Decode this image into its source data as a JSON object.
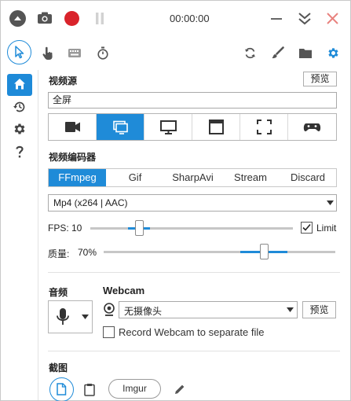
{
  "titlebar": {
    "timer": "00:00:00"
  },
  "sidebar": {},
  "video_source": {
    "title": "视频源",
    "preview_label": "预览",
    "source_value": "全屏"
  },
  "encoder": {
    "title": "视频编码器",
    "tabs": [
      "FFmpeg",
      "Gif",
      "SharpAvi",
      "Stream",
      "Discard"
    ],
    "selected": "FFmpeg",
    "format_value": "Mp4 (x264 | AAC)"
  },
  "fps": {
    "label": "FPS:",
    "value": "10",
    "limit_label": "Limit",
    "limit_checked": true,
    "level": 0.23
  },
  "quality": {
    "label": "质量:",
    "value": "70%",
    "level": 0.7
  },
  "audio": {
    "title": "音频"
  },
  "webcam": {
    "title": "Webcam",
    "device_value": "无摄像头",
    "preview_label": "预览",
    "separate_label": "Record Webcam to separate file"
  },
  "screenshot": {
    "title": "截图",
    "imgur_label": "Imgur"
  },
  "colors": {
    "accent": "#1f8bd8",
    "record": "#d9232b"
  }
}
